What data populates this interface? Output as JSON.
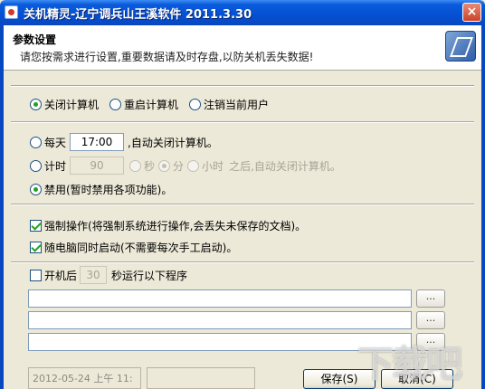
{
  "window": {
    "title": "关机精灵-辽宁调兵山王溪软件 2011.3.30",
    "close_label": "×"
  },
  "header": {
    "title": "参数设置",
    "subtitle": "请您按需求进行设置,重要数据请及时存盘,以防关机丢失数据!"
  },
  "mode": {
    "options": [
      "关闭计算机",
      "重启计算机",
      "注销当前用户"
    ],
    "selected": 0
  },
  "schedule": {
    "daily_label": "每天",
    "daily_time": "17:00",
    "daily_suffix": ",自动关闭计算机。",
    "timer_label": "计时",
    "timer_value": "90",
    "unit_sec": "秒",
    "unit_min": "分",
    "unit_hour": "小时",
    "timer_suffix": "之后,自动关闭计算机。",
    "disable_label": "禁用(暂时禁用各项功能)。",
    "selected": "disable"
  },
  "options": {
    "force_label": "强制操作(将强制系统进行操作,会丢失未保存的文档)。",
    "force_checked": true,
    "autostart_label": "随电脑同时启动(不需要每次手工启动)。",
    "autostart_checked": true
  },
  "startup_program": {
    "prefix": "开机后",
    "seconds": "30",
    "suffix": "秒运行以下程序",
    "checked": false,
    "browse_label": "..."
  },
  "status": {
    "datetime": "2012-05-24 上午 11:"
  },
  "buttons": {
    "save": "保存(S)",
    "cancel": "取消(C)"
  },
  "watermark": "下载吧"
}
